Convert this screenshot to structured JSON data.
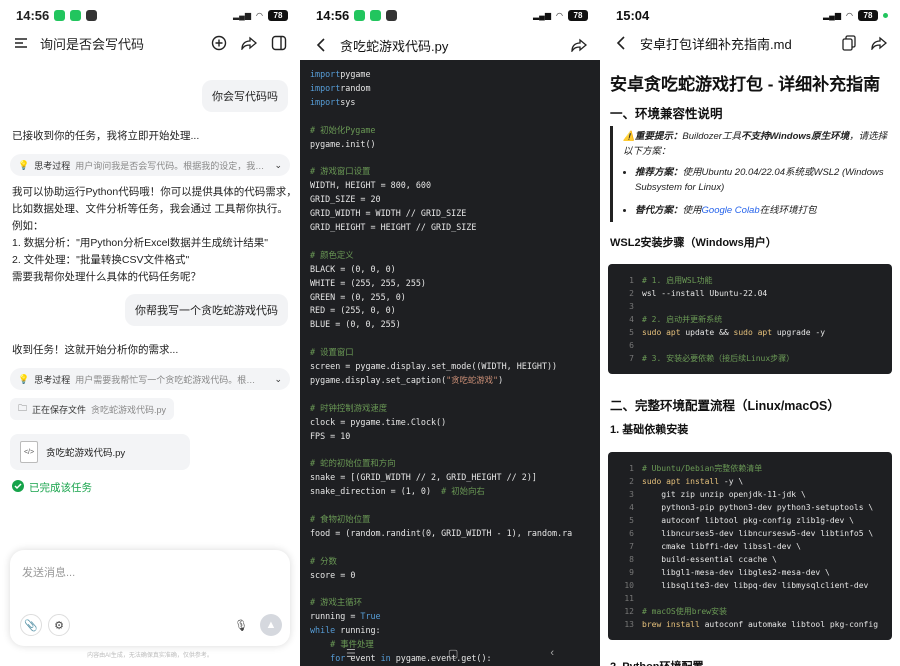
{
  "left": {
    "status": {
      "time": "14:56",
      "battery": "78"
    },
    "title": "询问是否会写代码",
    "messages": {
      "user1": "你会写代码吗",
      "bot1": "已接收到你的任务，我将立即开始处理...",
      "think1_label": "思考过程",
      "think1_text": "用户询问我是否会写代码。根据我的设定，我…",
      "answer": [
        "我可以协助运行Python代码哦！你可以提供具体的代码需求，",
        "比如数据处理、文件分析等任务，我会通过    工具帮你执行。",
        "例如：",
        "1. 数据分析：\"用Python分析Excel数据并生成统计结果\"",
        "2. 文件处理：\"批量转换CSV文件格式\"",
        "需要我帮你处理什么具体的代码任务呢？"
      ],
      "user2": "你帮我写一个贪吃蛇游戏代码",
      "bot2": "收到任务！这就开始分析你的需求...",
      "think2_label": "思考过程",
      "think2_text": "用户需要我帮忙写一个贪吃蛇游戏代码。根…",
      "saving_label": "正在保存文件",
      "saving_file": "贪吃蛇游戏代码.py",
      "file_card": "贪吃蛇游戏代码.py",
      "done": "已完成该任务"
    },
    "input_placeholder": "发送消息...",
    "disclaimer": "内容由AI生成，无法确保真实准确，仅供参考。"
  },
  "middle": {
    "status": {
      "time": "14:56",
      "battery": "78"
    },
    "title": "贪吃蛇游戏代码.py",
    "code_lines": [
      [
        [
          "kw",
          "import"
        ],
        [
          "",
          "pygame"
        ]
      ],
      [
        [
          "kw",
          "import"
        ],
        [
          "",
          "random"
        ]
      ],
      [
        [
          "kw",
          "import"
        ],
        [
          "",
          "sys"
        ]
      ],
      [],
      [
        [
          "cm",
          "# 初始化Pygame"
        ]
      ],
      [
        [
          "",
          "pygame.init()"
        ]
      ],
      [],
      [
        [
          "cm",
          "# 游戏窗口设置"
        ]
      ],
      [
        [
          "",
          "WIDTH, HEIGHT = 800, 600"
        ]
      ],
      [
        [
          "",
          "GRID_SIZE = 20"
        ]
      ],
      [
        [
          "",
          "GRID_WIDTH = WIDTH // GRID_SIZE"
        ]
      ],
      [
        [
          "",
          "GRID_HEIGHT = HEIGHT // GRID_SIZE"
        ]
      ],
      [],
      [
        [
          "cm",
          "# 颜色定义"
        ]
      ],
      [
        [
          "",
          "BLACK = (0, 0, 0)"
        ]
      ],
      [
        [
          "",
          "WHITE = (255, 255, 255)"
        ]
      ],
      [
        [
          "",
          "GREEN = (0, 255, 0)"
        ]
      ],
      [
        [
          "",
          "RED = (255, 0, 0)"
        ]
      ],
      [
        [
          "",
          "BLUE = (0, 0, 255)"
        ]
      ],
      [],
      [
        [
          "cm",
          "# 设置窗口"
        ]
      ],
      [
        [
          "",
          "screen = pygame.display.set_mode((WIDTH, HEIGHT))"
        ]
      ],
      [
        [
          "",
          "pygame.display.set_caption("
        ],
        [
          "st",
          "\"贪吃蛇游戏\""
        ],
        [
          "",
          ")"
        ]
      ],
      [],
      [
        [
          "cm",
          "# 时钟控制游戏速度"
        ]
      ],
      [
        [
          "",
          "clock = pygame.time.Clock()"
        ]
      ],
      [
        [
          "",
          "FPS = 10"
        ]
      ],
      [],
      [
        [
          "cm",
          "# 蛇的初始位置和方向"
        ]
      ],
      [
        [
          "",
          "snake = [(GRID_WIDTH // 2, GRID_HEIGHT // 2)]"
        ]
      ],
      [
        [
          "",
          "snake_direction = (1, 0)  "
        ],
        [
          "cm",
          "# 初始向右"
        ]
      ],
      [],
      [
        [
          "cm",
          "# 食物初始位置"
        ]
      ],
      [
        [
          "",
          "food = (random.randint(0, GRID_WIDTH - 1), random.ra"
        ]
      ],
      [],
      [
        [
          "cm",
          "# 分数"
        ]
      ],
      [
        [
          "",
          "score = 0"
        ]
      ],
      [],
      [
        [
          "cm",
          "# 游戏主循环"
        ]
      ],
      [
        [
          "",
          "running = "
        ],
        [
          "kw",
          "True"
        ]
      ],
      [
        [
          "kw",
          "while"
        ],
        [
          "",
          " running:"
        ]
      ],
      [
        [
          "cm",
          "    # 事件处理"
        ]
      ],
      [
        [
          "kw",
          "    for"
        ],
        [
          "",
          " event "
        ],
        [
          "kw",
          "in"
        ],
        [
          "",
          " pygame.event.get():"
        ]
      ]
    ]
  },
  "right": {
    "status": {
      "time": "15:04",
      "battery": "78"
    },
    "title": "安卓打包详细补充指南.md",
    "h1": "安卓贪吃蛇游戏打包 - 详细补充指南",
    "sec1": "一、环境兼容性说明",
    "note_label": "重要提示：",
    "note_text1": "Buildozer工具",
    "note_bold": "不支持Windows原生环境",
    "note_text2": "，请选择以下方案：",
    "opt1_label": "推荐方案：",
    "opt1_text": "使用Ubuntu 20.04/22.04系统或WSL2 (Windows Subsystem for Linux)",
    "opt2_label": "替代方案：",
    "opt2_pre": "使用",
    "opt2_link": "Google Colab",
    "opt2_post": "在线环境打包",
    "wsl_title": "WSL2安装步骤（Windows用户）",
    "wsl_code": [
      [
        [
          "cm",
          "# 1. 启用WSL功能"
        ]
      ],
      [
        [
          "",
          "wsl --install Ubuntu-22.04"
        ]
      ],
      [],
      [
        [
          "cm",
          "# 2. 启动并更新系统"
        ]
      ],
      [
        [
          "y",
          "sudo apt"
        ],
        [
          "",
          " update && "
        ],
        [
          "y",
          "sudo apt"
        ],
        [
          "",
          " upgrade -y"
        ]
      ],
      [],
      [
        [
          "cm",
          "# 3. 安装必要依赖（接后续Linux步骤）"
        ]
      ]
    ],
    "sec2": "二、完整环境配置流程（Linux/macOS）",
    "sub1": "1. 基础依赖安装",
    "deps_code": [
      [
        [
          "cm",
          "# Ubuntu/Debian完整依赖清单"
        ]
      ],
      [
        [
          "y",
          "sudo apt install"
        ],
        [
          "",
          " -y \\"
        ]
      ],
      [
        [
          "",
          "    git zip unzip openjdk-11-jdk \\"
        ]
      ],
      [
        [
          "",
          "    python3-pip python3-dev python3-setuptools \\"
        ]
      ],
      [
        [
          "",
          "    autoconf libtool pkg-config zlib1g-dev \\"
        ]
      ],
      [
        [
          "",
          "    libncurses5-dev libncursesw5-dev libtinfo5 \\"
        ]
      ],
      [
        [
          "",
          "    cmake libffi-dev libssl-dev \\"
        ]
      ],
      [
        [
          "",
          "    build-essential ccache \\"
        ]
      ],
      [
        [
          "",
          "    libgl1-mesa-dev libgles2-mesa-dev \\"
        ]
      ],
      [
        [
          "",
          "    libsqlite3-dev libpq-dev libmysqlclient-dev"
        ]
      ],
      [],
      [
        [
          "cm",
          "# macOS使用brew安装"
        ]
      ],
      [
        [
          "y",
          "brew install"
        ],
        [
          "",
          " autoconf automake libtool pkg-config"
        ]
      ]
    ],
    "sub2": "2. Python环境配置"
  }
}
